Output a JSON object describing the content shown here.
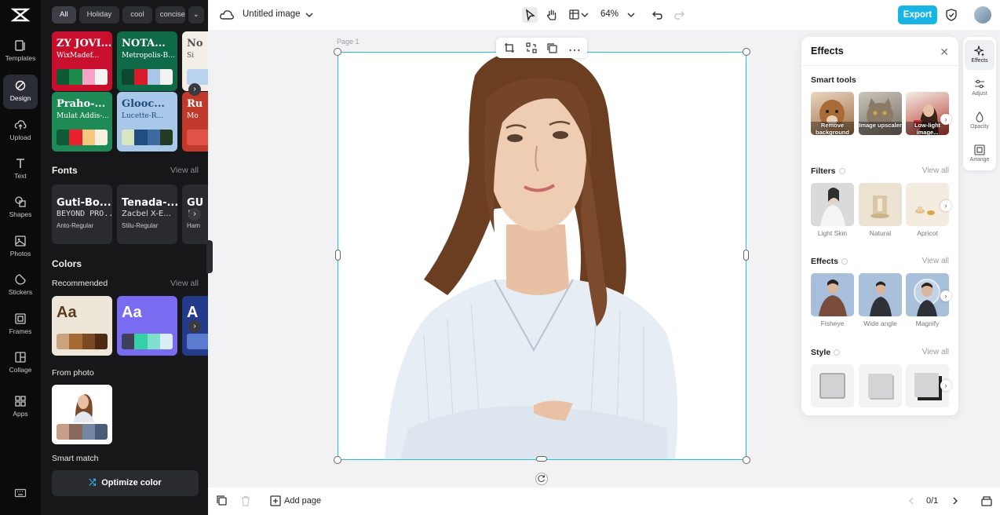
{
  "rail": {
    "items": [
      {
        "label": "Templates",
        "icon": "templates-icon"
      },
      {
        "label": "Design",
        "icon": "design-icon"
      },
      {
        "label": "Upload",
        "icon": "upload-icon"
      },
      {
        "label": "Text",
        "icon": "text-icon"
      },
      {
        "label": "Shapes",
        "icon": "shapes-icon"
      },
      {
        "label": "Photos",
        "icon": "photos-icon"
      },
      {
        "label": "Stickers",
        "icon": "stickers-icon"
      },
      {
        "label": "Frames",
        "icon": "frames-icon"
      },
      {
        "label": "Collage",
        "icon": "collage-icon"
      },
      {
        "label": "Apps",
        "icon": "apps-icon"
      }
    ],
    "active": "Design"
  },
  "panel": {
    "chips": [
      "All",
      "Holiday",
      "cool",
      "concise"
    ],
    "style_tiles": [
      {
        "title": "ZY JOVI...",
        "sub": "WixMadef...",
        "bg": "#c8102e",
        "fg": "#ffffff",
        "swatches": [
          "#0e5a34",
          "#1d8c4a",
          "#f5a3c7",
          "#f3f3f3"
        ]
      },
      {
        "title": "NOTA...",
        "sub": "Metropolis-B...",
        "bg": "#0f6a48",
        "fg": "#ffffff",
        "swatches": [
          "#0b4a30",
          "#d91c2a",
          "#a8c6e8",
          "#f2f2f2"
        ]
      },
      {
        "title": "No",
        "sub": "Si",
        "bg": "#f3efe6",
        "fg": "#555555",
        "swatches": [
          "#b9d2ef",
          "#e9dcc4"
        ]
      },
      {
        "title": "Praho-...",
        "sub": "Mulat Addis-...",
        "bg": "#1e8a55",
        "fg": "#ffffff",
        "swatches": [
          "#0f5b36",
          "#e8222e",
          "#f4c77d",
          "#f6f0e0"
        ]
      },
      {
        "title": "Glooc...",
        "sub": "Lucette-R...",
        "bg": "#a8c8ea",
        "fg": "#1e4a7a",
        "swatches": [
          "#d7e6c0",
          "#1f4e80",
          "#3f6aa0",
          "#233b22"
        ]
      },
      {
        "title": "Ru",
        "sub": "Mo",
        "bg": "#c0392b",
        "fg": "#ffffff",
        "swatches": [
          "#e05346"
        ]
      }
    ],
    "fonts": {
      "title": "Fonts",
      "view_all": "View all",
      "items": [
        {
          "l1": "Guti-Bo...",
          "l2": "BEYOND PRO...",
          "l3": "Anto-Regular"
        },
        {
          "l1": "Tenada-...",
          "l2": "Zacbel X-E...",
          "l3": "Stilu-Regular"
        },
        {
          "l1": "GU",
          "l2": "[",
          "l3": "Ham"
        }
      ]
    },
    "colors": {
      "title": "Colors",
      "recommended": "Recommended",
      "view_all": "View all",
      "tiles": [
        {
          "aa": "Aa",
          "bg": "#efe6da",
          "fg": "#5b3a1e",
          "swatches": [
            "#c9a37d",
            "#a76a34",
            "#7a4a22",
            "#4e2a14"
          ]
        },
        {
          "aa": "Aa",
          "bg": "#7a6cf0",
          "fg": "#ffffff",
          "swatches": [
            "#40405a",
            "#36d0a7",
            "#7ee0cc",
            "#d9eef7"
          ]
        },
        {
          "aa": "A",
          "bg": "#243a8a",
          "fg": "#ffffff",
          "swatches": [
            "#5a7bd0"
          ]
        }
      ],
      "from_photo": "From photo",
      "photo_swatches": [
        "#c79f88",
        "#8a6a5c",
        "#7486a6",
        "#4a5b7a"
      ]
    },
    "smart_match": "Smart match",
    "optimize_label": "Optimize color"
  },
  "topbar": {
    "doc_title": "Untitled image",
    "zoom": "64%",
    "export_label": "Export"
  },
  "canvas": {
    "page_label": "Page 1"
  },
  "bottombar": {
    "add_page": "Add page",
    "page_counter": "0/1"
  },
  "effects_panel": {
    "title": "Effects",
    "smart_tools": {
      "title": "Smart tools",
      "items": [
        "Remove background",
        "Image upscaler",
        "Low-light image..."
      ]
    },
    "filters": {
      "title": "Filters",
      "view_all": "View all",
      "items": [
        "Light Skin",
        "Natural",
        "Apricot"
      ]
    },
    "effects": {
      "title": "Effects",
      "view_all": "View all",
      "items": [
        "Fisheye",
        "Wide angle",
        "Magnify"
      ]
    },
    "style": {
      "title": "Style",
      "view_all": "View all"
    }
  },
  "right_rail": {
    "items": [
      "Effects",
      "Adjust",
      "Opacity",
      "Arrange"
    ],
    "active": "Effects"
  },
  "colors": {
    "accent": "#18b5e4",
    "selection": "#27c1d4"
  }
}
